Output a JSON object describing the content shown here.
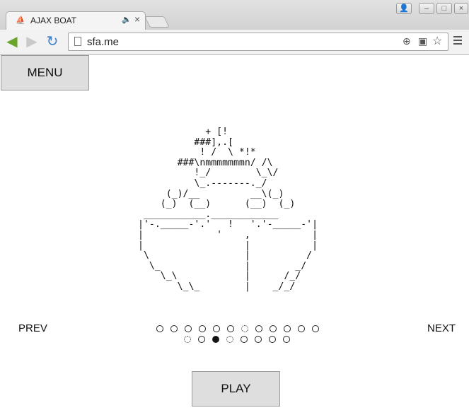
{
  "browser": {
    "tab_title": "AJAX BOAT",
    "url": "sfa.me"
  },
  "page": {
    "menu_label": "MENU",
    "prev_label": "PREV",
    "next_label": "NEXT",
    "play_label": "PLAY",
    "boat_art": "            + [!\n          ###],.[\n           ! /  \\ *!*\n       ###\\nmmmmmmmn/ /\\\n          !_/        \\_\\/\n          \\_.-------._/\n     (_)/__         __\\(_)\n    (_)  (__)      (__)  (_)\n ___________.____________\n|'-._____-'.'   !   '.'-_____-'|\n|             '    ,           |\n|                  |           |\n \\                 |          /\n  \\_               |        _/\n    \\_\\            |      /_/\n       \\_\\_        |    _/_/\n",
    "carousel": {
      "row1_count": 12,
      "row1_current_index": 6,
      "row2_count": 8,
      "row2_active_index": 2,
      "row2_dotted_indices": [
        0,
        3
      ]
    }
  }
}
